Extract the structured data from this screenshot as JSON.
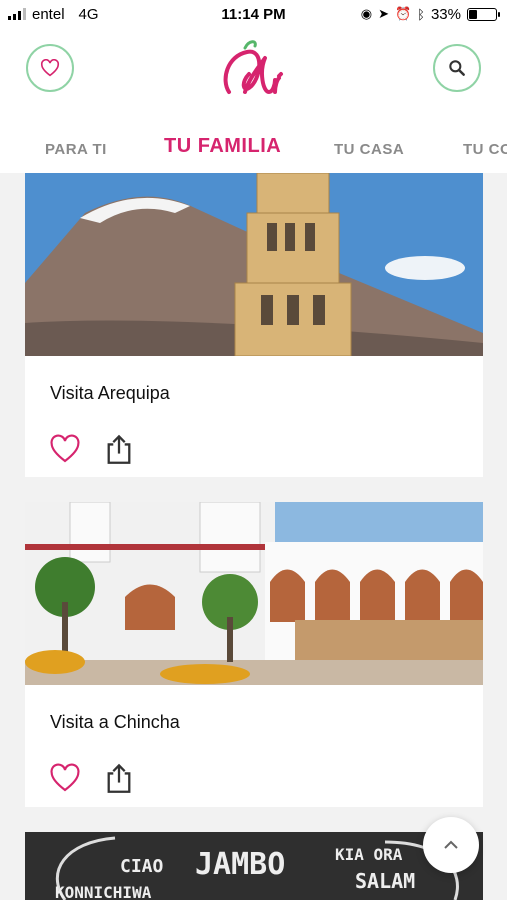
{
  "status_bar": {
    "carrier": "entel",
    "network": "4G",
    "time": "11:14 PM",
    "battery": "33%",
    "battery_level": 0.33
  },
  "header": {
    "logo_text": "Al",
    "tabs": [
      {
        "label": "PARA TI"
      },
      {
        "label": "TU FAMILIA"
      },
      {
        "label": "TU CASA"
      },
      {
        "label": "TU CO"
      }
    ]
  },
  "cards": [
    {
      "title": "Visita Arequipa"
    },
    {
      "title": "Visita a Chincha"
    },
    {
      "words": [
        "CIAO",
        "JAMBO",
        "KIA ORA",
        "SALAM",
        "KONNICHIWA"
      ]
    }
  ],
  "colors": {
    "accent": "#d6246e",
    "icon_ring": "#8fd3a5"
  }
}
